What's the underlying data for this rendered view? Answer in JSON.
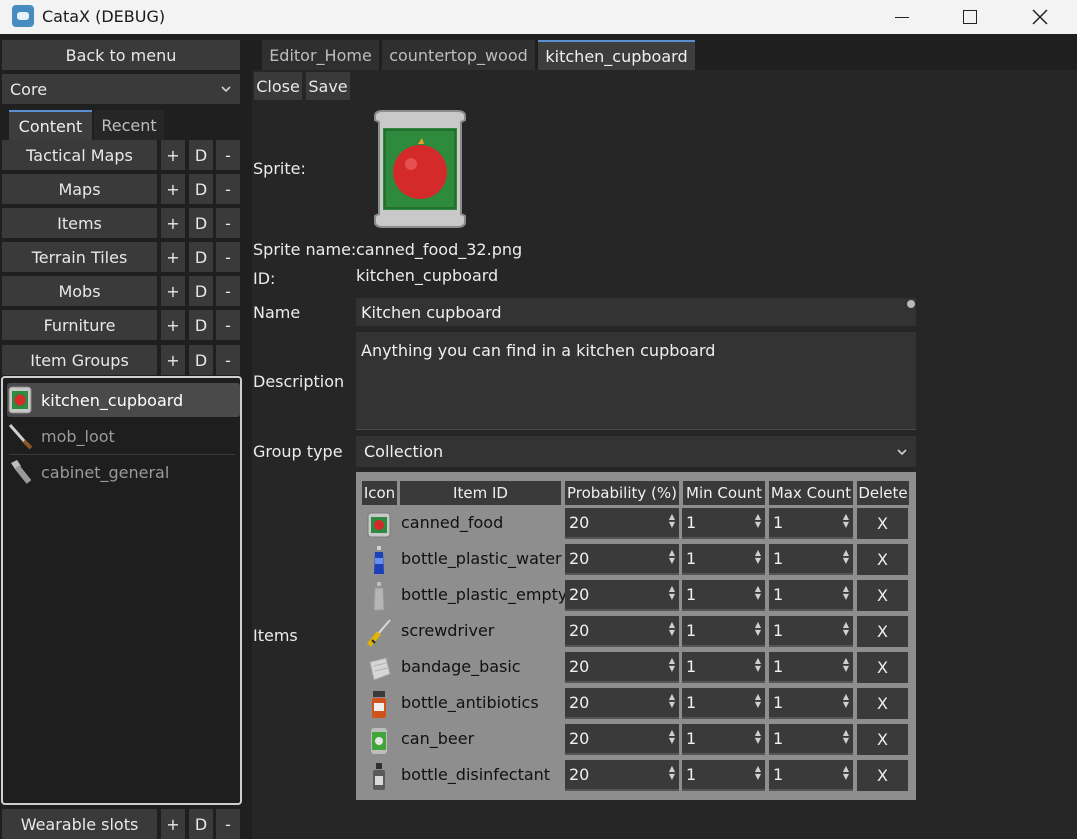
{
  "window": {
    "title": "CataX (DEBUG)"
  },
  "left": {
    "back_label": "Back to menu",
    "mod_select": "Core",
    "tabs": [
      {
        "label": "Content"
      },
      {
        "label": "Recent"
      }
    ],
    "categories": [
      {
        "label": "Tactical Maps",
        "add": "+",
        "dup": "D",
        "del": "-"
      },
      {
        "label": "Maps",
        "add": "+",
        "dup": "D",
        "del": "-"
      },
      {
        "label": "Items",
        "add": "+",
        "dup": "D",
        "del": "-"
      },
      {
        "label": "Terrain Tiles",
        "add": "+",
        "dup": "D",
        "del": "-"
      },
      {
        "label": "Mobs",
        "add": "+",
        "dup": "D",
        "del": "-"
      },
      {
        "label": "Furniture",
        "add": "+",
        "dup": "D",
        "del": "-"
      },
      {
        "label": "Item Groups",
        "add": "+",
        "dup": "D",
        "del": "-"
      }
    ],
    "list": [
      {
        "label": "kitchen_cupboard",
        "icon": "canned-food-icon"
      },
      {
        "label": "mob_loot",
        "icon": "knife-icon"
      },
      {
        "label": "cabinet_general",
        "icon": "flashlight-icon"
      }
    ],
    "wearable": {
      "label": "Wearable slots",
      "add": "+",
      "dup": "D",
      "del": "-"
    }
  },
  "editor": {
    "tabs": [
      {
        "label": "Editor_Home"
      },
      {
        "label": "countertop_wood"
      },
      {
        "label": "kitchen_cupboard"
      }
    ],
    "close_label": "Close",
    "save_label": "Save",
    "sprite_label": "Sprite:",
    "sprite_name_label": "Sprite name:",
    "sprite_name": "canned_food_32.png",
    "id_label": "ID:",
    "id": "kitchen_cupboard",
    "name_label": "Name",
    "name": "Kitchen cupboard",
    "description_label": "Description",
    "description": "Anything you can find in a kitchen cupboard",
    "group_type_label": "Group type",
    "group_type": "Collection",
    "items_label": "Items",
    "columns": [
      "Icon",
      "Item ID",
      "Probability (%)",
      "Min Count",
      "Max Count",
      "Delete"
    ],
    "rows": [
      {
        "id": "canned_food",
        "prob": "20",
        "min": "1",
        "max": "1",
        "del": "X",
        "icon": "canned-food-icon"
      },
      {
        "id": "bottle_plastic_water",
        "prob": "20",
        "min": "1",
        "max": "1",
        "del": "X",
        "icon": "water-bottle-icon"
      },
      {
        "id": "bottle_plastic_empty",
        "prob": "20",
        "min": "1",
        "max": "1",
        "del": "X",
        "icon": "empty-bottle-icon"
      },
      {
        "id": "screwdriver",
        "prob": "20",
        "min": "1",
        "max": "1",
        "del": "X",
        "icon": "screwdriver-icon"
      },
      {
        "id": "bandage_basic",
        "prob": "20",
        "min": "1",
        "max": "1",
        "del": "X",
        "icon": "bandage-icon"
      },
      {
        "id": "bottle_antibiotics",
        "prob": "20",
        "min": "1",
        "max": "1",
        "del": "X",
        "icon": "pill-bottle-icon"
      },
      {
        "id": "can_beer",
        "prob": "20",
        "min": "1",
        "max": "1",
        "del": "X",
        "icon": "beer-can-icon"
      },
      {
        "id": "bottle_disinfectant",
        "prob": "20",
        "min": "1",
        "max": "1",
        "del": "X",
        "icon": "spray-bottle-icon"
      }
    ]
  }
}
